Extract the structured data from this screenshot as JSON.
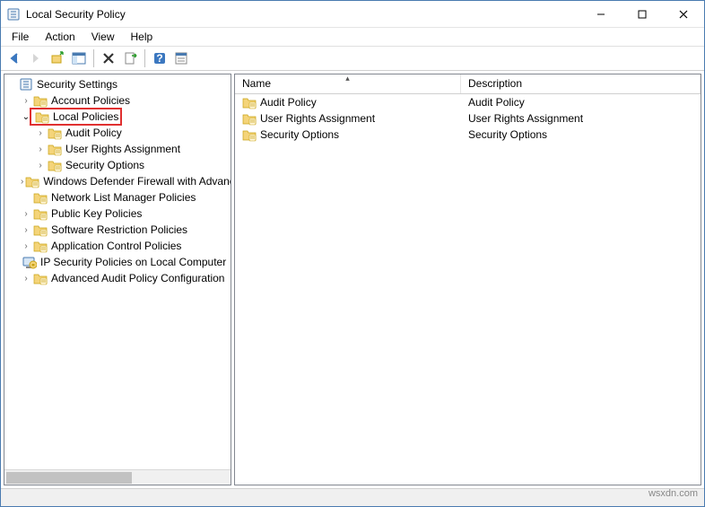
{
  "window": {
    "title": "Local Security Policy"
  },
  "menubar": {
    "items": [
      "File",
      "Action",
      "View",
      "Help"
    ]
  },
  "tree": {
    "root_label": "Security Settings",
    "nodes": [
      {
        "label": "Account Policies",
        "expandable": true,
        "open": false,
        "depth": 1,
        "highlighted": false
      },
      {
        "label": "Local Policies",
        "expandable": true,
        "open": true,
        "depth": 1,
        "highlighted": true
      },
      {
        "label": "Audit Policy",
        "expandable": true,
        "open": false,
        "depth": 2,
        "highlighted": false
      },
      {
        "label": "User Rights Assignment",
        "expandable": true,
        "open": false,
        "depth": 2,
        "highlighted": false
      },
      {
        "label": "Security Options",
        "expandable": true,
        "open": false,
        "depth": 2,
        "highlighted": false
      },
      {
        "label": "Windows Defender Firewall with Advanced Security",
        "expandable": true,
        "open": false,
        "depth": 1,
        "highlighted": false
      },
      {
        "label": "Network List Manager Policies",
        "expandable": false,
        "open": false,
        "depth": 1,
        "highlighted": false
      },
      {
        "label": "Public Key Policies",
        "expandable": true,
        "open": false,
        "depth": 1,
        "highlighted": false
      },
      {
        "label": "Software Restriction Policies",
        "expandable": true,
        "open": false,
        "depth": 1,
        "highlighted": false
      },
      {
        "label": "Application Control Policies",
        "expandable": true,
        "open": false,
        "depth": 1,
        "highlighted": false
      },
      {
        "label": "IP Security Policies on Local Computer",
        "expandable": false,
        "open": false,
        "depth": 1,
        "highlighted": false,
        "icon": "ipsec"
      },
      {
        "label": "Advanced Audit Policy Configuration",
        "expandable": true,
        "open": false,
        "depth": 1,
        "highlighted": false
      }
    ]
  },
  "list": {
    "columns": {
      "name": "Name",
      "description": "Description",
      "sorted": "name",
      "dir": "asc"
    },
    "rows": [
      {
        "name": "Audit Policy",
        "description": "Audit Policy"
      },
      {
        "name": "User Rights Assignment",
        "description": "User Rights Assignment"
      },
      {
        "name": "Security Options",
        "description": "Security Options"
      }
    ]
  },
  "watermark": "wsxdn.com"
}
